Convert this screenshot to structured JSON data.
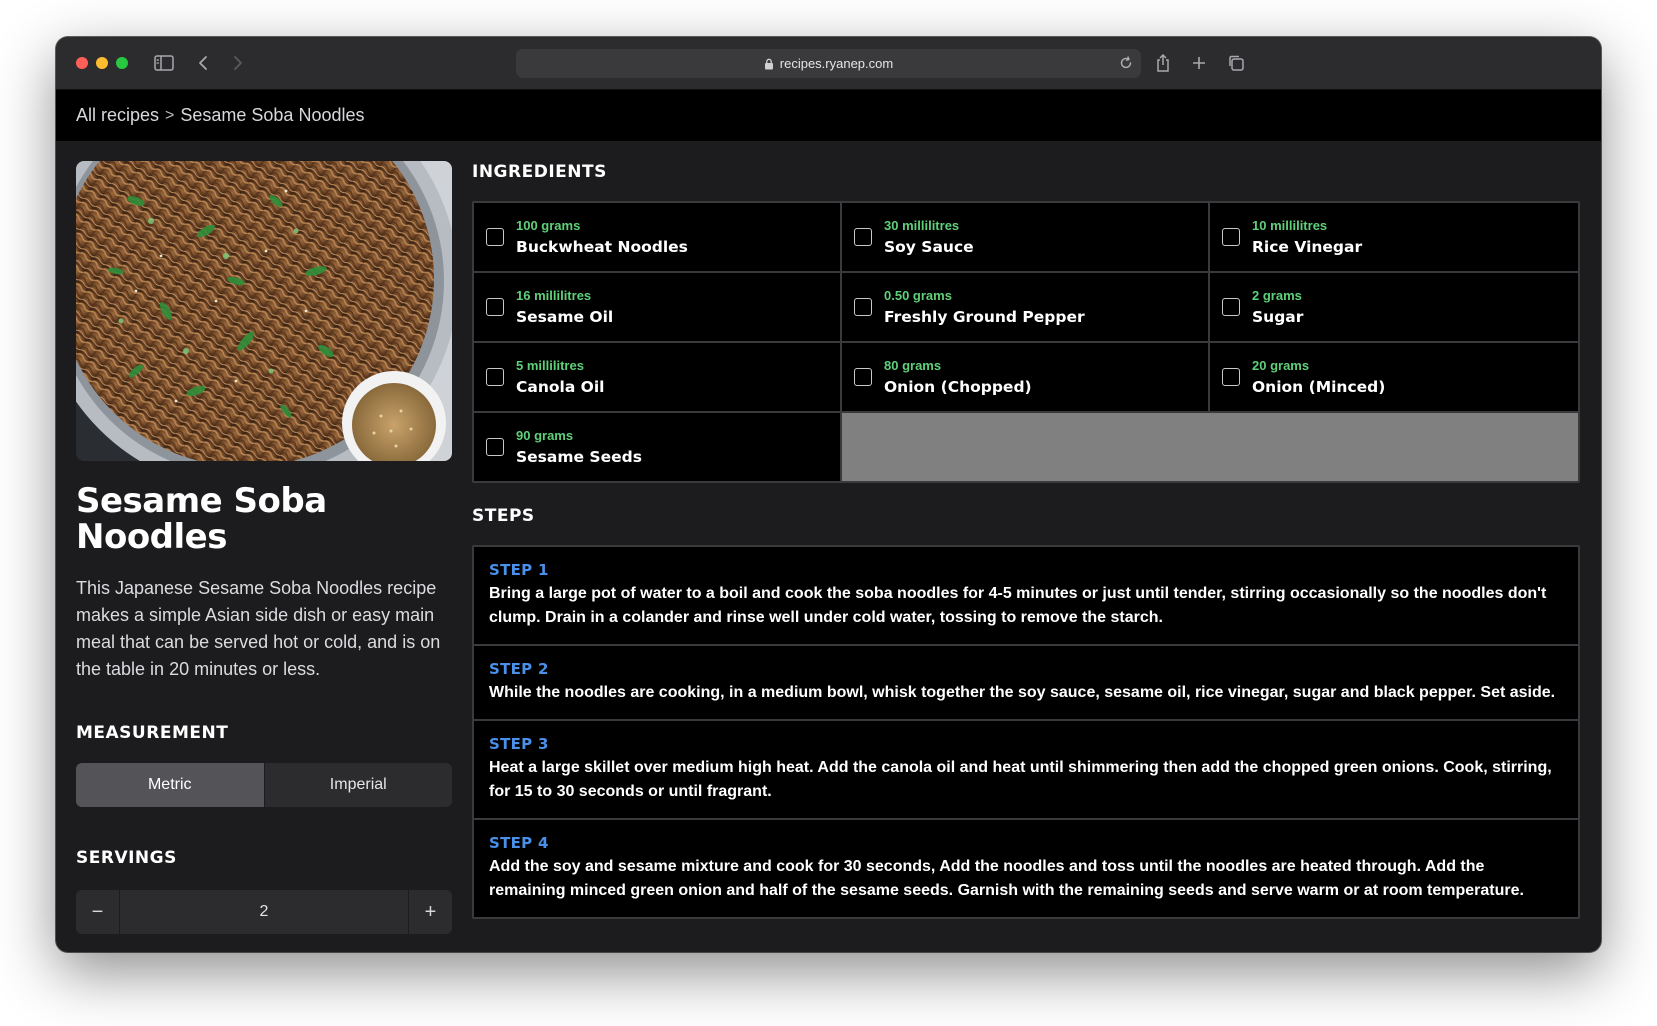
{
  "browser": {
    "url": "recipes.ryanep.com"
  },
  "breadcrumb": {
    "root": "All recipes",
    "separator": ">",
    "current": "Sesame Soba Noodles"
  },
  "recipe": {
    "title": "Sesame Soba Noodles",
    "description": "This Japanese Sesame Soba Noodles recipe makes a simple Asian side dish or easy main meal that can be served hot or cold, and is on the table in 20 minutes or less."
  },
  "measurement": {
    "heading": "MEASUREMENT",
    "options": [
      "Metric",
      "Imperial"
    ],
    "selected": "Metric"
  },
  "servings": {
    "heading": "SERVINGS",
    "value": "2",
    "decrement": "−",
    "increment": "+"
  },
  "ingredients": {
    "heading": "INGREDIENTS",
    "items": [
      {
        "qty": "100 grams",
        "name": "Buckwheat Noodles"
      },
      {
        "qty": "30 millilitres",
        "name": "Soy Sauce"
      },
      {
        "qty": "10 millilitres",
        "name": "Rice Vinegar"
      },
      {
        "qty": "16 millilitres",
        "name": "Sesame Oil"
      },
      {
        "qty": "0.50 grams",
        "name": "Freshly Ground Pepper"
      },
      {
        "qty": "2 grams",
        "name": "Sugar"
      },
      {
        "qty": "5 millilitres",
        "name": "Canola Oil"
      },
      {
        "qty": "80 grams",
        "name": "Onion (Chopped)"
      },
      {
        "qty": "20 grams",
        "name": "Onion (Minced)"
      },
      {
        "qty": "90 grams",
        "name": "Sesame Seeds"
      }
    ]
  },
  "steps": {
    "heading": "STEPS",
    "items": [
      {
        "label": "STEP 1",
        "text": "Bring a large pot of water to a boil and cook the soba noodles for 4-5 minutes or just until tender, stirring occasionally so the noodles don't clump. Drain in a colander and rinse well under cold water, tossing to remove the starch."
      },
      {
        "label": "STEP 2",
        "text": "While the noodles are cooking, in a medium bowl, whisk together the soy sauce, sesame oil, rice vinegar, sugar and black pepper. Set aside."
      },
      {
        "label": "STEP 3",
        "text": "Heat a large skillet over medium high heat. Add the canola oil and heat until shimmering then add the chopped green onions. Cook, stirring, for 15 to 30 seconds or until fragrant."
      },
      {
        "label": "STEP 4",
        "text": "Add the soy and sesame mixture and cook for 30 seconds, Add the noodles and toss until the noodles are heated through. Add the remaining minced green onion and half of the sesame seeds. Garnish with the remaining seeds and serve warm or at room temperature."
      }
    ]
  }
}
